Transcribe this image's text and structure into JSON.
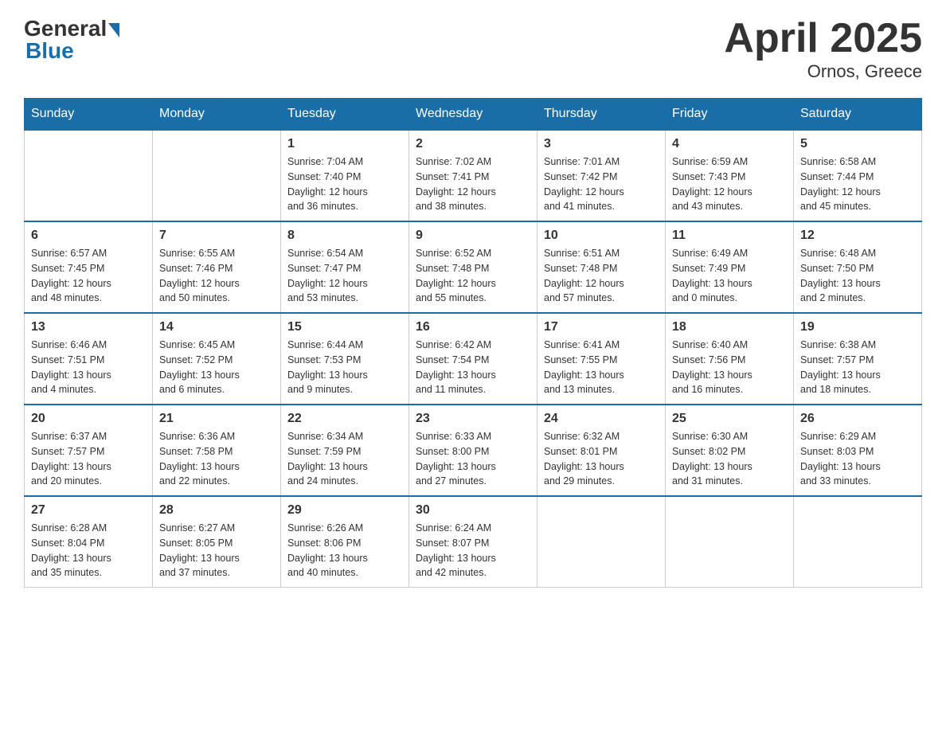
{
  "header": {
    "logo_general": "General",
    "logo_blue": "Blue",
    "title": "April 2025",
    "subtitle": "Ornos, Greece"
  },
  "weekdays": [
    "Sunday",
    "Monday",
    "Tuesday",
    "Wednesday",
    "Thursday",
    "Friday",
    "Saturday"
  ],
  "weeks": [
    [
      {
        "day": "",
        "info": ""
      },
      {
        "day": "",
        "info": ""
      },
      {
        "day": "1",
        "info": "Sunrise: 7:04 AM\nSunset: 7:40 PM\nDaylight: 12 hours\nand 36 minutes."
      },
      {
        "day": "2",
        "info": "Sunrise: 7:02 AM\nSunset: 7:41 PM\nDaylight: 12 hours\nand 38 minutes."
      },
      {
        "day": "3",
        "info": "Sunrise: 7:01 AM\nSunset: 7:42 PM\nDaylight: 12 hours\nand 41 minutes."
      },
      {
        "day": "4",
        "info": "Sunrise: 6:59 AM\nSunset: 7:43 PM\nDaylight: 12 hours\nand 43 minutes."
      },
      {
        "day": "5",
        "info": "Sunrise: 6:58 AM\nSunset: 7:44 PM\nDaylight: 12 hours\nand 45 minutes."
      }
    ],
    [
      {
        "day": "6",
        "info": "Sunrise: 6:57 AM\nSunset: 7:45 PM\nDaylight: 12 hours\nand 48 minutes."
      },
      {
        "day": "7",
        "info": "Sunrise: 6:55 AM\nSunset: 7:46 PM\nDaylight: 12 hours\nand 50 minutes."
      },
      {
        "day": "8",
        "info": "Sunrise: 6:54 AM\nSunset: 7:47 PM\nDaylight: 12 hours\nand 53 minutes."
      },
      {
        "day": "9",
        "info": "Sunrise: 6:52 AM\nSunset: 7:48 PM\nDaylight: 12 hours\nand 55 minutes."
      },
      {
        "day": "10",
        "info": "Sunrise: 6:51 AM\nSunset: 7:48 PM\nDaylight: 12 hours\nand 57 minutes."
      },
      {
        "day": "11",
        "info": "Sunrise: 6:49 AM\nSunset: 7:49 PM\nDaylight: 13 hours\nand 0 minutes."
      },
      {
        "day": "12",
        "info": "Sunrise: 6:48 AM\nSunset: 7:50 PM\nDaylight: 13 hours\nand 2 minutes."
      }
    ],
    [
      {
        "day": "13",
        "info": "Sunrise: 6:46 AM\nSunset: 7:51 PM\nDaylight: 13 hours\nand 4 minutes."
      },
      {
        "day": "14",
        "info": "Sunrise: 6:45 AM\nSunset: 7:52 PM\nDaylight: 13 hours\nand 6 minutes."
      },
      {
        "day": "15",
        "info": "Sunrise: 6:44 AM\nSunset: 7:53 PM\nDaylight: 13 hours\nand 9 minutes."
      },
      {
        "day": "16",
        "info": "Sunrise: 6:42 AM\nSunset: 7:54 PM\nDaylight: 13 hours\nand 11 minutes."
      },
      {
        "day": "17",
        "info": "Sunrise: 6:41 AM\nSunset: 7:55 PM\nDaylight: 13 hours\nand 13 minutes."
      },
      {
        "day": "18",
        "info": "Sunrise: 6:40 AM\nSunset: 7:56 PM\nDaylight: 13 hours\nand 16 minutes."
      },
      {
        "day": "19",
        "info": "Sunrise: 6:38 AM\nSunset: 7:57 PM\nDaylight: 13 hours\nand 18 minutes."
      }
    ],
    [
      {
        "day": "20",
        "info": "Sunrise: 6:37 AM\nSunset: 7:57 PM\nDaylight: 13 hours\nand 20 minutes."
      },
      {
        "day": "21",
        "info": "Sunrise: 6:36 AM\nSunset: 7:58 PM\nDaylight: 13 hours\nand 22 minutes."
      },
      {
        "day": "22",
        "info": "Sunrise: 6:34 AM\nSunset: 7:59 PM\nDaylight: 13 hours\nand 24 minutes."
      },
      {
        "day": "23",
        "info": "Sunrise: 6:33 AM\nSunset: 8:00 PM\nDaylight: 13 hours\nand 27 minutes."
      },
      {
        "day": "24",
        "info": "Sunrise: 6:32 AM\nSunset: 8:01 PM\nDaylight: 13 hours\nand 29 minutes."
      },
      {
        "day": "25",
        "info": "Sunrise: 6:30 AM\nSunset: 8:02 PM\nDaylight: 13 hours\nand 31 minutes."
      },
      {
        "day": "26",
        "info": "Sunrise: 6:29 AM\nSunset: 8:03 PM\nDaylight: 13 hours\nand 33 minutes."
      }
    ],
    [
      {
        "day": "27",
        "info": "Sunrise: 6:28 AM\nSunset: 8:04 PM\nDaylight: 13 hours\nand 35 minutes."
      },
      {
        "day": "28",
        "info": "Sunrise: 6:27 AM\nSunset: 8:05 PM\nDaylight: 13 hours\nand 37 minutes."
      },
      {
        "day": "29",
        "info": "Sunrise: 6:26 AM\nSunset: 8:06 PM\nDaylight: 13 hours\nand 40 minutes."
      },
      {
        "day": "30",
        "info": "Sunrise: 6:24 AM\nSunset: 8:07 PM\nDaylight: 13 hours\nand 42 minutes."
      },
      {
        "day": "",
        "info": ""
      },
      {
        "day": "",
        "info": ""
      },
      {
        "day": "",
        "info": ""
      }
    ]
  ]
}
